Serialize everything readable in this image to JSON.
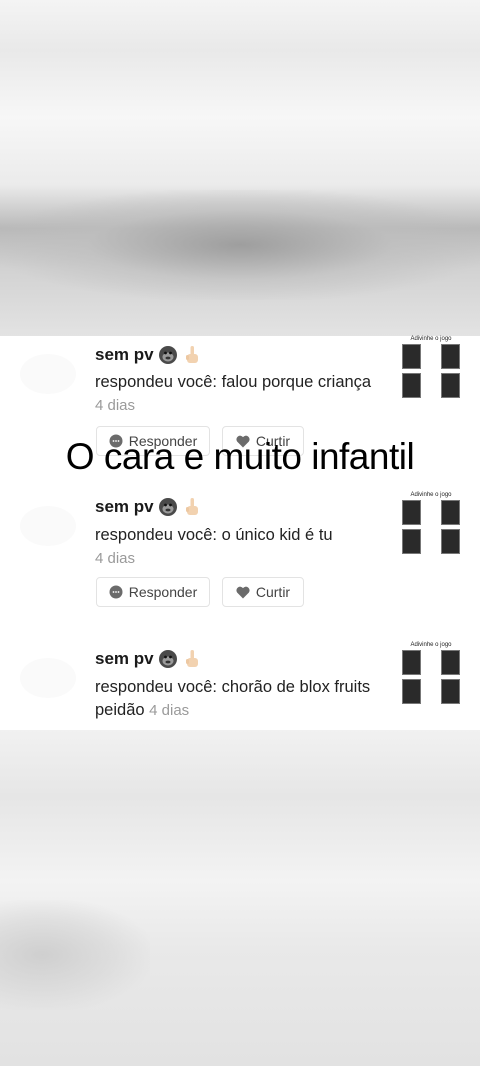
{
  "overlay_caption": "O cara e muito infantil",
  "comments": [
    {
      "username": "sem pv",
      "text": "respondeu você: falou porque criança",
      "time": "4 dias",
      "reply_label": "Responder",
      "like_label": "Curtir",
      "thumb_title": "Adivinhe o jogo"
    },
    {
      "username": "sem pv",
      "text": "respondeu você: o único kid é tu",
      "time": "4 dias",
      "reply_label": "Responder",
      "like_label": "Curtir",
      "thumb_title": "Adivinhe o jogo"
    },
    {
      "username": "sem pv",
      "text": "respondeu você: chorão de blox fruits peidão",
      "time": "4 dias",
      "thumb_title": "Adivinhe o jogo"
    }
  ],
  "icons": {
    "user_emojis": [
      "gorilla-emoji",
      "middle-finger-emoji"
    ],
    "reply_icon": "speech-bubble-icon",
    "like_icon": "heart-icon"
  }
}
